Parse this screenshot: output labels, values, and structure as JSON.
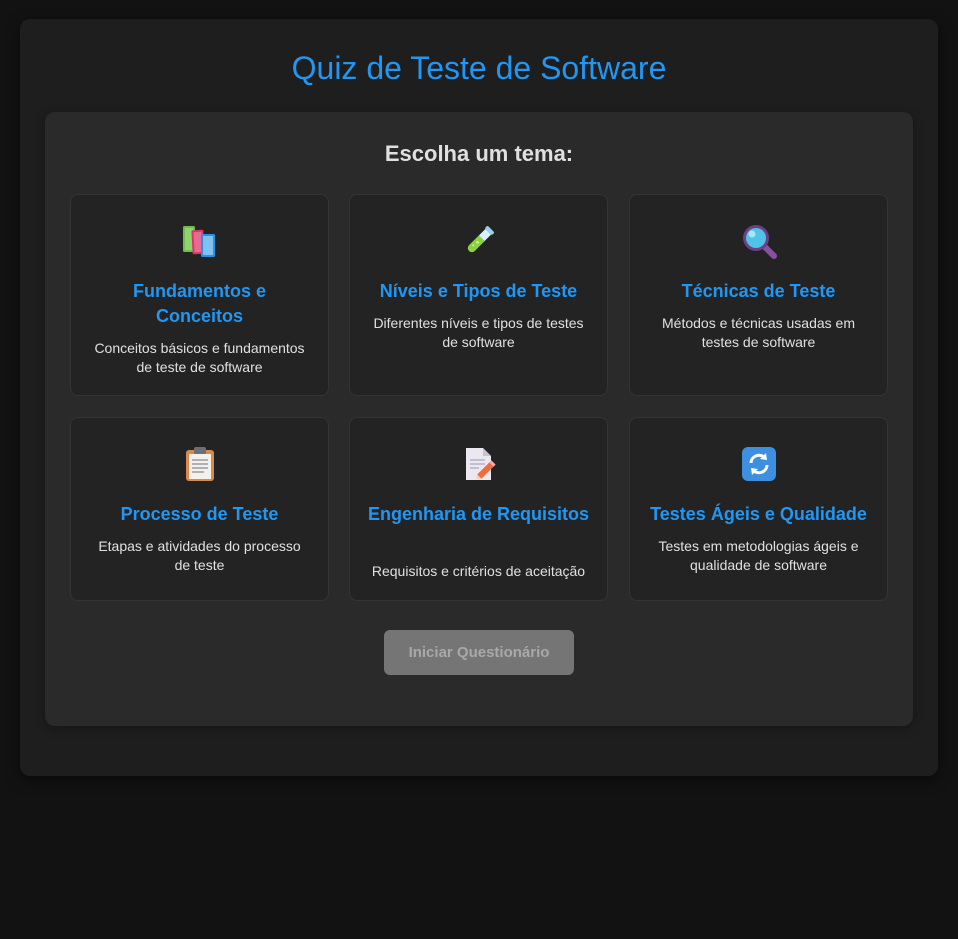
{
  "header": {
    "title": "Quiz de Teste de Software"
  },
  "topics": {
    "heading": "Escolha um tema:",
    "items": [
      {
        "title": "Fundamentos e Conceitos",
        "description": "Conceitos básicos e fundamentos de teste de software",
        "icon": "books-icon"
      },
      {
        "title": "Níveis e Tipos de Teste",
        "description": "Diferentes níveis e tipos de testes de software",
        "icon": "test-tube-icon"
      },
      {
        "title": "Técnicas de Teste",
        "description": "Métodos e técnicas usadas em testes de software",
        "icon": "magnifying-glass-icon"
      },
      {
        "title": "Processo de Teste",
        "description": "Etapas e atividades do processo de teste",
        "icon": "clipboard-icon"
      },
      {
        "title": "Engenharia de Requisitos",
        "description": "Requisitos e critérios de aceitação",
        "icon": "document-pencil-icon"
      },
      {
        "title": "Testes Ágeis e Qualidade",
        "description": "Testes em metodologias ágeis e qualidade de software",
        "icon": "refresh-icon"
      }
    ]
  },
  "actions": {
    "start_label": "Iniciar Questionário",
    "start_disabled": true
  },
  "colors": {
    "accent": "#2196f3",
    "background": "#121212",
    "container": "#1e1e1e",
    "panel": "#2a2a2a",
    "card": "#232323",
    "button_disabled": "#757575"
  }
}
